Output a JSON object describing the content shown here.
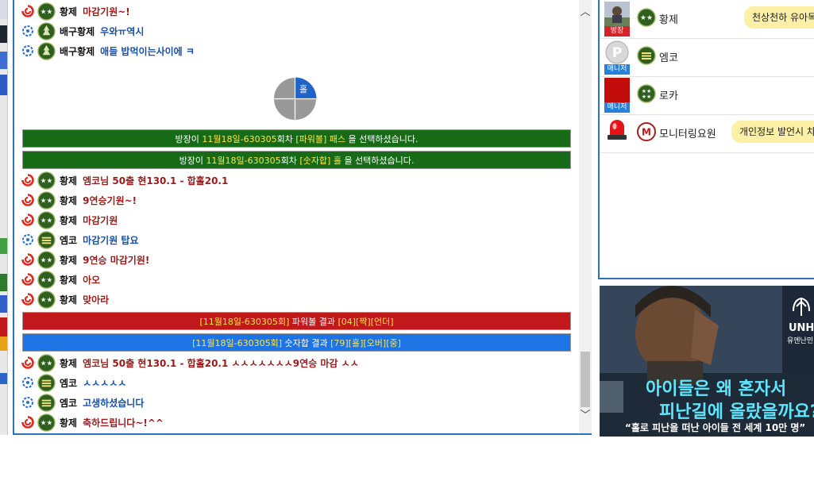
{
  "chat": {
    "top_messages": [
      {
        "rank": "red",
        "badge": "star2",
        "nick": "황제",
        "text": "마감기원~!",
        "color": "red"
      },
      {
        "rank": "blue",
        "badge": "pine",
        "nick": "배구황제",
        "text": "우와ㅠ역시",
        "color": "blue"
      },
      {
        "rank": "blue",
        "badge": "pine",
        "nick": "배구황제",
        "text": "애들 밥먹이는사이에 ㅋ",
        "color": "blue"
      }
    ],
    "pie_label": "홀",
    "announce_1": {
      "pre": "방장이 ",
      "round": "11월18일-630305",
      "mid": "회차 ",
      "pick": "[파워볼] 패스",
      "post": " 을 선택하셨습니다."
    },
    "announce_2": {
      "pre": "방장이 ",
      "round": "11월18일-630305",
      "mid": "회차 ",
      "pick": "[숫자합] 홀",
      "post": " 을 선택하셨습니다."
    },
    "mid_messages": [
      {
        "rank": "red",
        "badge": "star2",
        "nick": "황제",
        "text": "엠코님 50출 현130.1 - 합홀20.1",
        "color": "red"
      },
      {
        "rank": "red",
        "badge": "star2",
        "nick": "황제",
        "text": "9연승기원~!",
        "color": "red"
      },
      {
        "rank": "red",
        "badge": "star2",
        "nick": "황제",
        "text": "마감기원",
        "color": "red"
      },
      {
        "rank": "blue",
        "badge": "bar3",
        "nick": "엠코",
        "text": "마감기원 탑요",
        "color": "blue"
      },
      {
        "rank": "red",
        "badge": "star2",
        "nick": "황제",
        "text": "9연승 마감기원!",
        "color": "red"
      },
      {
        "rank": "red",
        "badge": "star2",
        "nick": "황제",
        "text": "아오",
        "color": "red"
      },
      {
        "rank": "red",
        "badge": "star2",
        "nick": "황제",
        "text": "맞아라",
        "color": "red"
      }
    ],
    "result_powerball": {
      "round": "[11월18일-630305회]",
      "label": " 파워볼 결과 ",
      "values": "[04][짝][언더]"
    },
    "result_sum": {
      "round": "[11월18일-630305회]",
      "label": " 숫자합 결과 ",
      "values": "[79][홀][오버][중]"
    },
    "bottom_messages": [
      {
        "rank": "red",
        "badge": "star2",
        "nick": "황제",
        "text": "엠코님 50출 현130.1 - 합홀20.1 ㅅㅅㅅㅅㅅㅅㅅ9연승 마감 ㅅㅅ",
        "color": "red"
      },
      {
        "rank": "blue",
        "badge": "bar3",
        "nick": "엠코",
        "text": "ㅅㅅㅅㅅㅅ",
        "color": "blue"
      },
      {
        "rank": "blue",
        "badge": "bar3",
        "nick": "엠코",
        "text": "고생하셨습니다",
        "color": "blue"
      },
      {
        "rank": "red",
        "badge": "star2",
        "nick": "황제",
        "text": "축하드립니다~!^^",
        "color": "red"
      }
    ]
  },
  "users": [
    {
      "name": "황제",
      "role": "방장",
      "avatar": "person-photo",
      "badge": "star2",
      "status": "천상천하 유아독"
    },
    {
      "name": "엠코",
      "role": "매니저",
      "avatar": "p-logo",
      "badge": "bar3",
      "status": ""
    },
    {
      "name": "로카",
      "role": "매니저",
      "avatar": "red-square",
      "badge": "star4",
      "status": ""
    },
    {
      "name": "모니터링요원",
      "role": "",
      "avatar": "siren",
      "badge": "m-logo",
      "status": "개인정보 발언시 차"
    }
  ],
  "ad": {
    "headline_1": "아이들은 왜 혼자서",
    "headline_2": "피난길에 올랐을까요?",
    "subline": "“홀로 피난을 떠난 아이들 전 세계 10만 명”",
    "org": "UNHC",
    "org_sub": "유엔난민"
  },
  "colors": {
    "accent": "#2d73b8",
    "green_bar": "#176b17",
    "red_bar": "#c0181b",
    "blue_bar": "#1e74e5",
    "highlight": "#ffe44a"
  }
}
